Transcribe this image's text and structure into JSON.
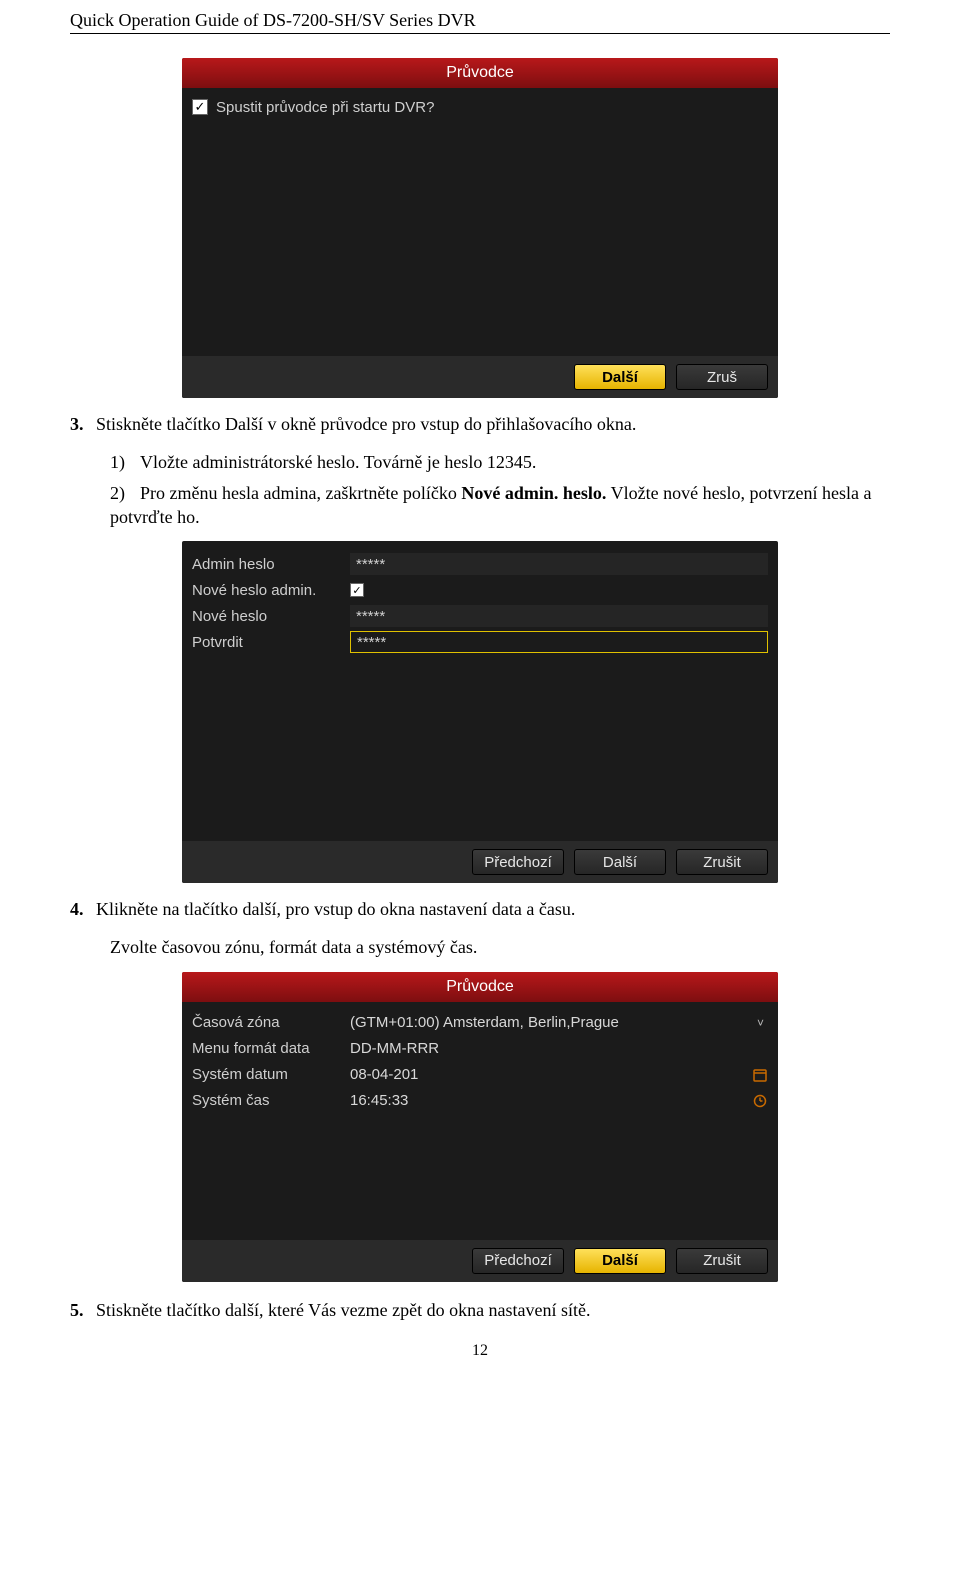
{
  "header": "Quick Operation Guide of DS-7200-SH/SV Series DVR",
  "panel1": {
    "title": "Průvodce",
    "checkbox_label": "Spustit průvodce při startu DVR?",
    "btn_next": "Další",
    "btn_cancel": "Zruš"
  },
  "step3": {
    "num": "3.",
    "text": "Stiskněte tlačítko Další v okně průvodce pro vstup do přihlašovacího okna."
  },
  "step3_sub1": {
    "num": "1)",
    "text": "Vložte administrátorské heslo. Továrně je heslo 12345."
  },
  "step3_sub2": {
    "num": "2)",
    "textA": "Pro změnu hesla admina, zaškrtněte políčko ",
    "bold": "Nové admin. heslo.",
    "textB": " Vložte nové heslo, potvrzení hesla a potvrďte ho."
  },
  "panel2": {
    "row_admin_label": "Admin heslo",
    "row_admin_value": "*****",
    "row_newadmin_label": "Nové heslo admin.",
    "row_newpass_label": "Nové heslo",
    "row_newpass_value": "*****",
    "row_confirm_label": "Potvrdit",
    "row_confirm_value": "*****",
    "btn_prev": "Předchozí",
    "btn_next": "Další",
    "btn_cancel": "Zrušit"
  },
  "step4": {
    "num": "4.",
    "text": "Klikněte na tlačítko další, pro vstup do okna nastavení data a času."
  },
  "step4_line2": "Zvolte časovou zónu, formát data a systémový čas.",
  "panel3": {
    "title": "Průvodce",
    "tz_label": "Časová zóna",
    "tz_value": "(GTM+01:00) Amsterdam, Berlin,Prague",
    "datefmt_label": "Menu formát data",
    "datefmt_value": "DD-MM-RRR",
    "sysdate_label": "Systém datum",
    "sysdate_value": "08-04-201",
    "systime_label": "Systém čas",
    "systime_value": "16:45:33",
    "btn_prev": "Předchozí",
    "btn_next": "Další",
    "btn_cancel": "Zrušit"
  },
  "step5": {
    "num": "5.",
    "text": "Stiskněte tlačítko další, které Vás vezme zpět do okna nastavení sítě."
  },
  "page_num": "12"
}
